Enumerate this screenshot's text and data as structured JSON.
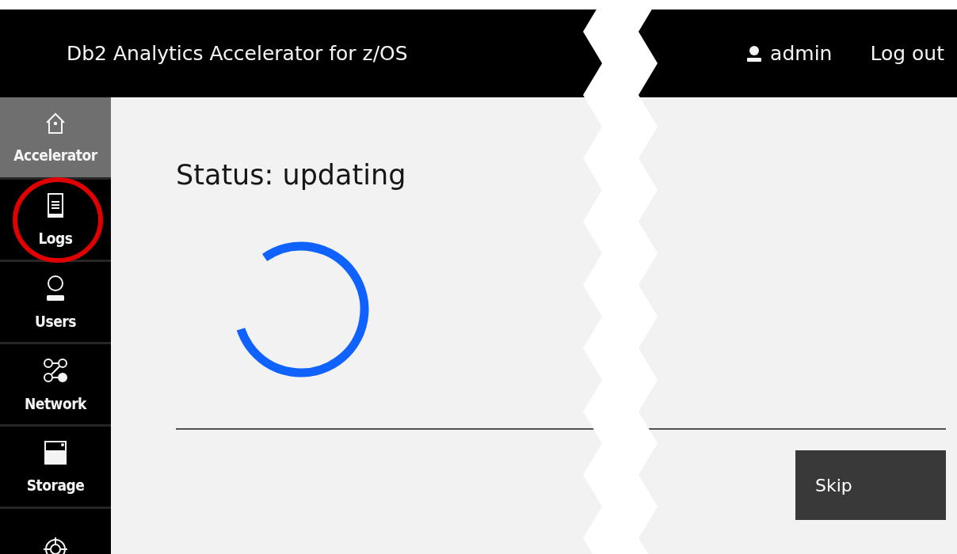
{
  "header": {
    "title": "Db2 Analytics Accelerator for z/OS",
    "user": "admin",
    "logout": "Log out"
  },
  "sidebar": {
    "items": [
      {
        "label": "Accelerator",
        "selected": true
      },
      {
        "label": "Logs",
        "selected": false
      },
      {
        "label": "Users",
        "selected": false
      },
      {
        "label": "Network",
        "selected": false
      },
      {
        "label": "Storage",
        "selected": false
      },
      {
        "selected": false
      }
    ]
  },
  "main": {
    "status": "Status: updating",
    "skip_button": "Skip"
  }
}
